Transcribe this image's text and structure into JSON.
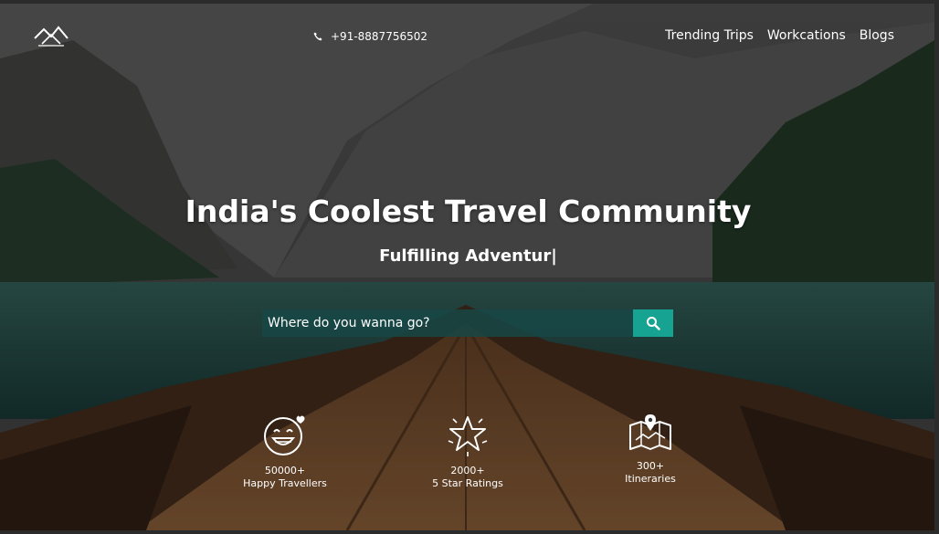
{
  "header": {
    "logo_icon": "mountain-tent-logo",
    "phone_icon": "phone-icon",
    "phone": "+91-8887756502",
    "nav": [
      {
        "label": "Trending Trips"
      },
      {
        "label": "Workcations"
      },
      {
        "label": "Blogs"
      }
    ]
  },
  "hero": {
    "title": "India's Coolest Travel Community",
    "subtitle": "Fulfilling Adventur|"
  },
  "search": {
    "placeholder": "Where do you wanna go?",
    "button_icon": "search-icon"
  },
  "stats": [
    {
      "icon": "happy-face-icon",
      "value": "50000+",
      "label": "Happy Travellers"
    },
    {
      "icon": "star-icon",
      "value": "2000+",
      "label": "5 Star Ratings"
    },
    {
      "icon": "map-pin-icon",
      "value": "300+",
      "label": "Itineraries"
    }
  ],
  "colors": {
    "accent": "#17a392",
    "text": "#ffffff"
  }
}
